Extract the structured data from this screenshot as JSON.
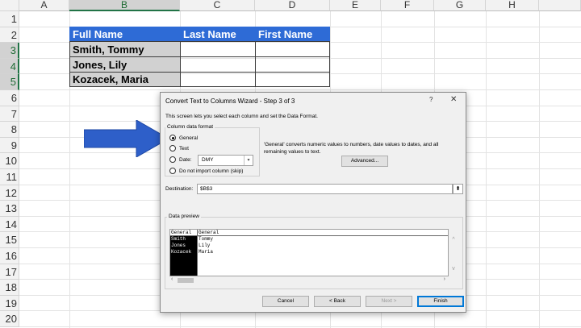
{
  "spreadsheet": {
    "columns": [
      "A",
      "B",
      "C",
      "D",
      "E",
      "F",
      "G",
      "H"
    ],
    "rows": [
      "1",
      "2",
      "3",
      "4",
      "5",
      "6",
      "7",
      "8",
      "9",
      "10",
      "11",
      "12",
      "13",
      "14",
      "15",
      "16",
      "17",
      "18",
      "19",
      "20"
    ],
    "table": {
      "headers": [
        "Full Name",
        "Last Name",
        "First Name"
      ],
      "rows": [
        [
          "Smith, Tommy",
          "",
          ""
        ],
        [
          "Jones, Lily",
          "",
          ""
        ],
        [
          "Kozacek, Maria",
          "",
          ""
        ]
      ]
    },
    "colors": {
      "header_fill": "#2e6bd6",
      "selection": "#217346"
    }
  },
  "dialog": {
    "title": "Convert Text to Columns Wizard - Step 3 of 3",
    "help": "?",
    "close": "✕",
    "intro": "This screen lets you select each column and set the Data Format.",
    "group_label": "Column data format",
    "options": {
      "general": "General",
      "text": "Text",
      "date": "Date:",
      "skip": "Do not import column (skip)"
    },
    "date_format": "DMY",
    "info_text": "'General' converts numeric values to numbers, date values to dates, and all remaining values to text.",
    "advanced_label": "Advanced...",
    "destination_label": "Destination:",
    "destination_value": "$B$3",
    "preview_label": "Data preview",
    "preview": {
      "col1_header": "General",
      "col2_header": "General",
      "col1_values": [
        "Smith",
        "Jones",
        "Kozacek"
      ],
      "col2_values": [
        "Tommy",
        "Lily",
        "Maria"
      ]
    },
    "buttons": {
      "cancel": "Cancel",
      "back": "< Back",
      "next": "Next >",
      "finish": "Finish"
    }
  }
}
